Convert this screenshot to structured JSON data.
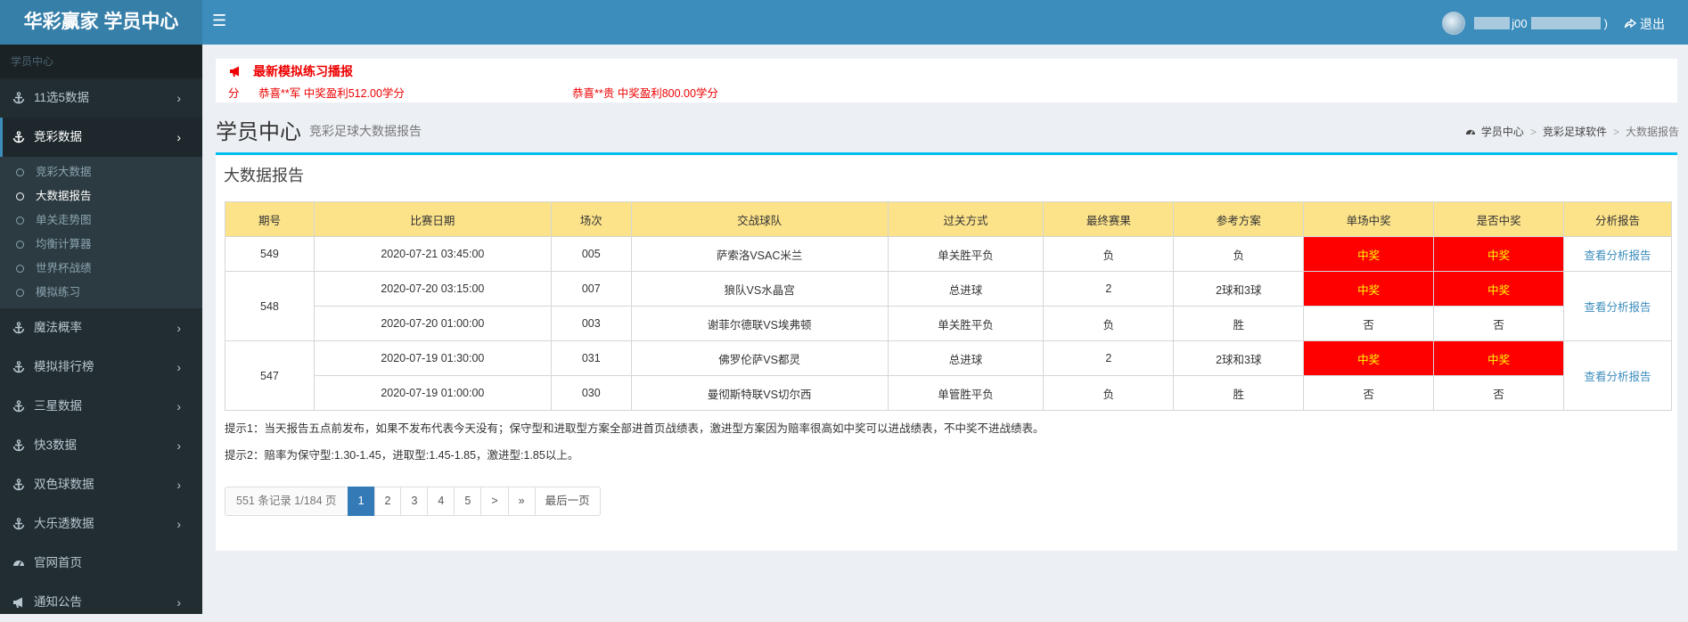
{
  "header": {
    "logo": "华彩赢家 学员中心",
    "user_prefix": "j00",
    "user_suffix": ")",
    "logout_label": "退出"
  },
  "sidebar": {
    "header": "学员中心",
    "items": [
      {
        "label": "11选5数据"
      },
      {
        "label": "竞彩数据"
      },
      {
        "label": "魔法概率"
      },
      {
        "label": "模拟排行榜"
      },
      {
        "label": "三星数据"
      },
      {
        "label": "快3数据"
      },
      {
        "label": "双色球数据"
      },
      {
        "label": "大乐透数据"
      },
      {
        "label": "官网首页"
      },
      {
        "label": "通知公告"
      }
    ],
    "submenu": [
      {
        "label": "竞彩大数据"
      },
      {
        "label": "大数据报告"
      },
      {
        "label": "单关走势图"
      },
      {
        "label": "均衡计算器"
      },
      {
        "label": "世界杯战绩"
      },
      {
        "label": "模拟练习"
      }
    ]
  },
  "news": {
    "title": "最新模拟练习播报",
    "items": [
      "分",
      "恭喜**军 中奖盈利512.00学分",
      "恭喜**贵 中奖盈利800.00学分"
    ]
  },
  "page": {
    "title": "学员中心",
    "subtitle": "竞彩足球大数据报告",
    "breadcrumb": [
      "学员中心",
      "竞彩足球软件",
      "大数据报告"
    ]
  },
  "report": {
    "title": "大数据报告",
    "columns": [
      "期号",
      "比赛日期",
      "场次",
      "交战球队",
      "过关方式",
      "最终赛果",
      "参考方案",
      "单场中奖",
      "是否中奖",
      "分析报告"
    ],
    "groups": [
      {
        "period": "549",
        "link": "查看分析报告",
        "rows": [
          {
            "date": "2020-07-21 03:45:00",
            "match_no": "005",
            "teams": "萨索洛VSAC米兰",
            "method": "单关胜平负",
            "result": "负",
            "plan": "负",
            "single": "中奖",
            "win": "中奖"
          }
        ]
      },
      {
        "period": "548",
        "link": "查看分析报告",
        "rows": [
          {
            "date": "2020-07-20 03:15:00",
            "match_no": "007",
            "teams": "狼队VS水晶宫",
            "method": "总进球",
            "result": "2",
            "plan": "2球和3球",
            "single": "中奖",
            "win": "中奖"
          },
          {
            "date": "2020-07-20 01:00:00",
            "match_no": "003",
            "teams": "谢菲尔德联VS埃弗顿",
            "method": "单关胜平负",
            "result": "负",
            "plan": "胜",
            "single": "否",
            "win": "否"
          }
        ]
      },
      {
        "period": "547",
        "link": "查看分析报告",
        "rows": [
          {
            "date": "2020-07-19 01:30:00",
            "match_no": "031",
            "teams": "佛罗伦萨VS都灵",
            "method": "总进球",
            "result": "2",
            "plan": "2球和3球",
            "single": "中奖",
            "win": "中奖"
          },
          {
            "date": "2020-07-19 01:00:00",
            "match_no": "030",
            "teams": "曼彻斯特联VS切尔西",
            "method": "单管胜平负",
            "result": "负",
            "plan": "胜",
            "single": "否",
            "win": "否"
          }
        ]
      }
    ],
    "tip1": "提示1：当天报告五点前发布，如果不发布代表今天没有；保守型和进取型方案全部进首页战绩表，激进型方案因为赔率很高如中奖可以进战绩表，不中奖不进战绩表。",
    "tip2": "提示2：赔率为保守型:1.30-1.45，进取型:1.45-1.85，激进型:1.85以上。"
  },
  "pagination": {
    "info": "551 条记录 1/184 页",
    "pages": [
      "1",
      "2",
      "3",
      "4",
      "5"
    ],
    "current": "1",
    "next": ">",
    "next_group": "»",
    "last": "最后一页"
  },
  "colors": {
    "topbar": "#3c8dbc",
    "sidebar": "#222d32",
    "win_bg": "#ff0000",
    "win_text": "#ffff00",
    "table_header": "#fce38a",
    "box_border": "#00c0ef"
  }
}
